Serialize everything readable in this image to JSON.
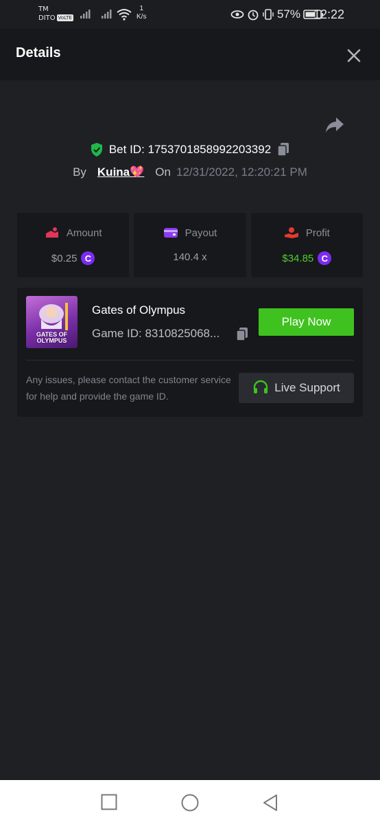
{
  "status_bar": {
    "carrier_line1": "TM",
    "carrier_line2": "DITO",
    "volte": "VoLTE",
    "speed_value": "1",
    "speed_unit": "K/s",
    "battery": "57%",
    "time": "12:22"
  },
  "header": {
    "title": "Details"
  },
  "bet": {
    "id_text": "Bet ID: 1753701858992203392",
    "by_label": "By",
    "username": "Kuina💖",
    "on_label": "On",
    "date": "12/31/2022, 12:20:21 PM"
  },
  "stats": [
    {
      "label": "Amount",
      "value": "$0.25",
      "color": "#e0365a"
    },
    {
      "label": "Payout",
      "value": "140.4 x",
      "color": "#8b3cf0"
    },
    {
      "label": "Profit",
      "value": "$34.85",
      "color": "#e23b2e"
    }
  ],
  "game": {
    "thumb_text_1": "GATES OF",
    "thumb_text_2": "OLYMPUS",
    "name": "Gates of Olympus",
    "game_id": "Game ID: 8310825068...",
    "play_label": "Play Now",
    "issue_text": "Any issues, please contact the customer service for help and provide the game ID.",
    "support_label": "Live Support"
  },
  "colors": {
    "accent_green": "#3fc21f",
    "coin_purple": "#7b2cf0",
    "background": "#1f2024",
    "card": "#17181b"
  },
  "icons": {
    "share": "share-icon",
    "shield": "shield-check-icon",
    "copy": "copy-icon",
    "close": "close-icon",
    "headset": "headset-icon"
  }
}
